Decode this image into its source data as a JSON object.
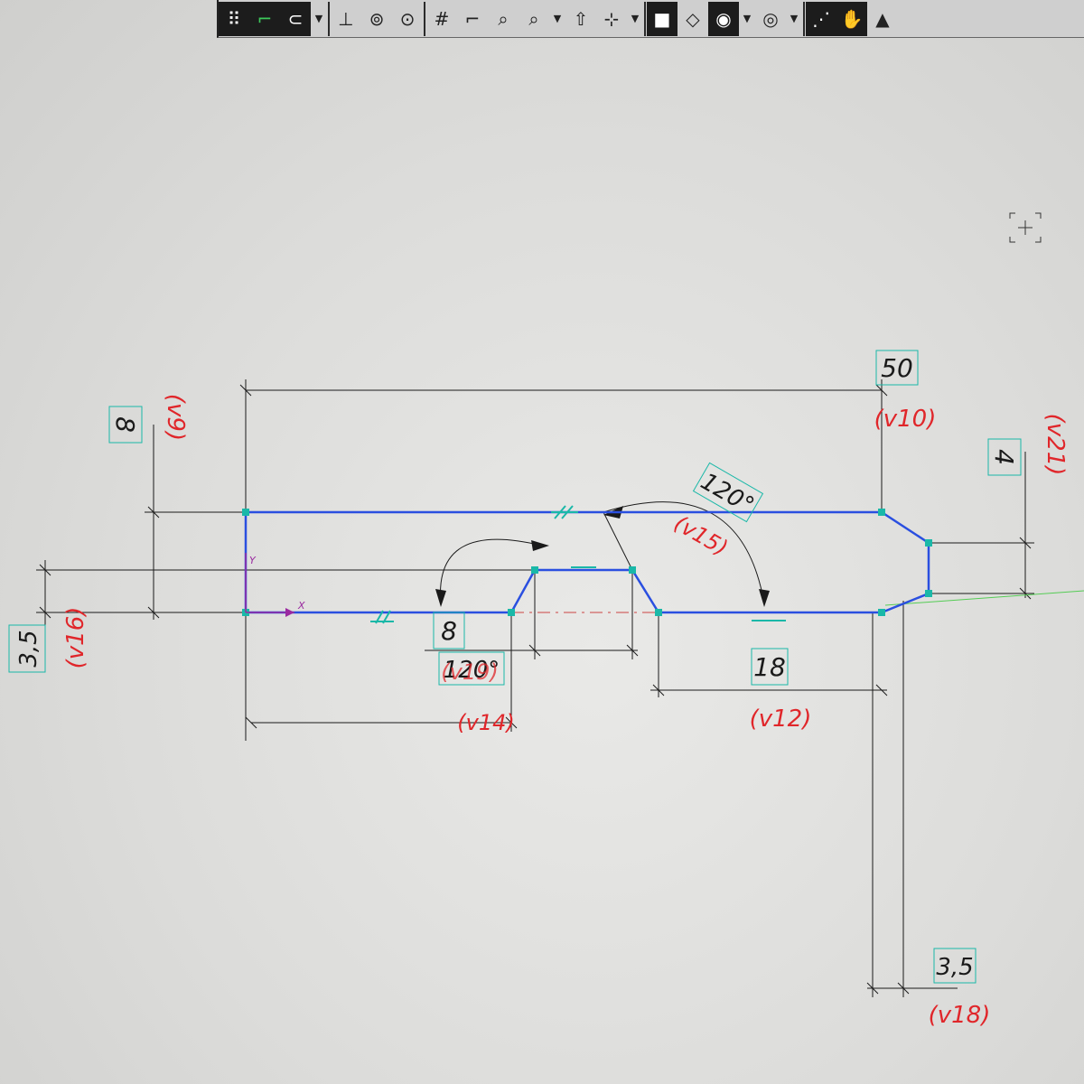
{
  "toolbar": {
    "buttons": [
      {
        "icon": "grid-dots-icon"
      },
      {
        "icon": "sketch-mode-icon"
      },
      {
        "icon": "magnet-snap-icon",
        "dropdown": true
      },
      {
        "icon": "perpendicular-icon"
      },
      {
        "icon": "view-normal-icon"
      },
      {
        "icon": "view-origin-icon"
      },
      {
        "icon": "grid-icon"
      },
      {
        "icon": "step-line-icon"
      },
      {
        "icon": "zoom-window-icon"
      },
      {
        "icon": "zoom-dynamic-icon",
        "dropdown": true
      },
      {
        "icon": "pan-icon"
      },
      {
        "icon": "orient-axes-icon",
        "dropdown": true
      },
      {
        "icon": "shaded-view-icon"
      },
      {
        "icon": "wireframe-view-icon"
      },
      {
        "icon": "hide-show-icon",
        "dropdown": true
      },
      {
        "icon": "visibility-icon",
        "dropdown": true
      },
      {
        "icon": "constraints-icon"
      },
      {
        "icon": "hand-tool-icon"
      },
      {
        "icon": "triangle-view-icon"
      }
    ]
  },
  "drawing": {
    "colors": {
      "profile": "#2a4fe0",
      "dimension": "#1a1a1a",
      "variable": "#e0262a",
      "constraint": "#1ab8a8",
      "axis": "#55cc55"
    },
    "dimensions": [
      {
        "id": "d50",
        "value": "50",
        "variable": "(v10)"
      },
      {
        "id": "d8",
        "value": "8",
        "variable": "(v9)"
      },
      {
        "id": "d4",
        "value": "4",
        "variable": "(v21)"
      },
      {
        "id": "d35left",
        "value": "3,5",
        "variable": "(v16)"
      },
      {
        "id": "d120",
        "value": "120°",
        "variable": "(v15)"
      },
      {
        "id": "d8inner",
        "value": "8",
        "variable": "(v14)"
      },
      {
        "id": "d120inner",
        "value": "120°",
        "variable": "(v19)"
      },
      {
        "id": "d18",
        "value": "18",
        "variable": "(v12)"
      },
      {
        "id": "d35bottom",
        "value": "3,5",
        "variable": "(v18)"
      }
    ],
    "axes": {
      "x": "X",
      "y": "Y"
    }
  }
}
